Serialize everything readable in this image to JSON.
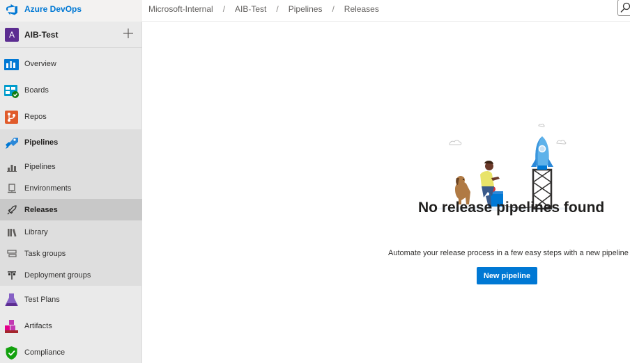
{
  "app": {
    "name": "Azure DevOps"
  },
  "breadcrumb": [
    "Microsoft-Internal",
    "AIB-Test",
    "Pipelines",
    "Releases"
  ],
  "breadcrumb_separator": "/",
  "project": {
    "initial": "A",
    "name": "AIB-Test",
    "add_icon": "plus-icon"
  },
  "sidebar": {
    "items": [
      {
        "label": "Overview",
        "icon": "overview-icon"
      },
      {
        "label": "Boards",
        "icon": "boards-icon"
      },
      {
        "label": "Repos",
        "icon": "repos-icon"
      },
      {
        "label": "Pipelines",
        "icon": "pipelines-icon"
      },
      {
        "label": "Test Plans",
        "icon": "test-plans-icon"
      },
      {
        "label": "Artifacts",
        "icon": "artifacts-icon"
      },
      {
        "label": "Compliance",
        "icon": "compliance-icon"
      }
    ],
    "pipeline_subitems": [
      {
        "label": "Pipelines",
        "icon": "pipelines-sub-icon"
      },
      {
        "label": "Environments",
        "icon": "environments-icon"
      },
      {
        "label": "Releases",
        "icon": "releases-icon",
        "active": true
      },
      {
        "label": "Library",
        "icon": "library-icon"
      },
      {
        "label": "Task groups",
        "icon": "task-groups-icon"
      },
      {
        "label": "Deployment groups",
        "icon": "deployment-groups-icon"
      }
    ]
  },
  "main": {
    "empty_title": "No release pipelines found",
    "empty_text": "Automate your release process in a few easy steps with a new pipeline",
    "new_button_label": "New pipeline"
  },
  "colors": {
    "accent": "#0078d4",
    "project_avatar": "#5c2d91",
    "sidebar_bg": "#eaeaea"
  }
}
